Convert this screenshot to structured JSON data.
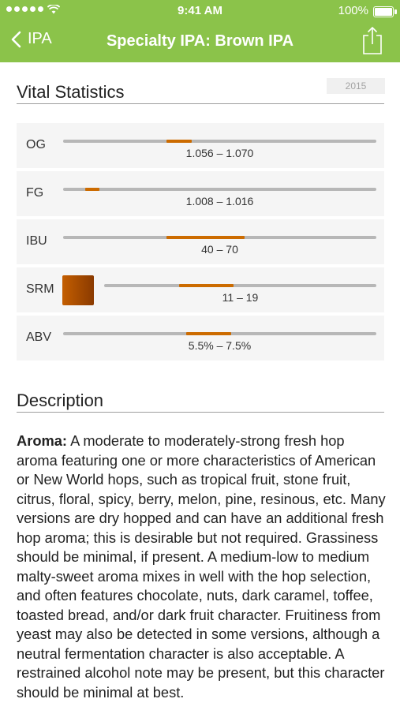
{
  "status_bar": {
    "time": "9:41 AM",
    "battery_percent": "100%"
  },
  "nav": {
    "back_label": "IPA",
    "title": "Specialty IPA: Brown IPA"
  },
  "vital_stats": {
    "heading": "Vital Statistics",
    "year": "2015",
    "rows": [
      {
        "label": "OG",
        "range_text": "1.056 – 1.070",
        "range_start": 0.33,
        "range_end": 0.41
      },
      {
        "label": "FG",
        "range_text": "1.008 – 1.016",
        "range_start": 0.07,
        "range_end": 0.115
      },
      {
        "label": "IBU",
        "range_text": "40 – 70",
        "range_start": 0.33,
        "range_end": 0.58
      },
      {
        "label": "SRM",
        "range_text": "11 – 19",
        "range_start": 0.276,
        "range_end": 0.476
      },
      {
        "label": "ABV",
        "range_text": "5.5% – 7.5%",
        "range_start": 0.393,
        "range_end": 0.536
      }
    ]
  },
  "description": {
    "heading": "Description",
    "aroma_label": "Aroma:",
    "aroma_text": " A moderate to moderately-strong fresh hop aroma featuring one or more characteristics of American or New World hops, such as tropical fruit, stone fruit, citrus, floral, spicy, berry, melon, pine, resinous, etc. Many versions are dry hopped and can have an additional fresh hop aroma; this is desirable but not required. Grassiness should be minimal, if present. A medium-low to medium malty-sweet aroma mixes in well with the hop selection, and often features chocolate, nuts, dark caramel, toffee, toasted bread, and/or dark fruit character. Fruitiness from yeast may also be detected in some versions, although a neutral fermentation character is also acceptable. A restrained alcohol note may be present, but this character should be minimal at best."
  },
  "colors": {
    "nav_green": "#8bc34a",
    "range_orange": "#cc6b00",
    "track_gray": "#b7b7b7",
    "srm_swatch": "#b35200"
  },
  "icons": [
    "back-chevron-icon",
    "share-icon",
    "wifi-icon",
    "battery-icon",
    "signal-dots-icon"
  ]
}
